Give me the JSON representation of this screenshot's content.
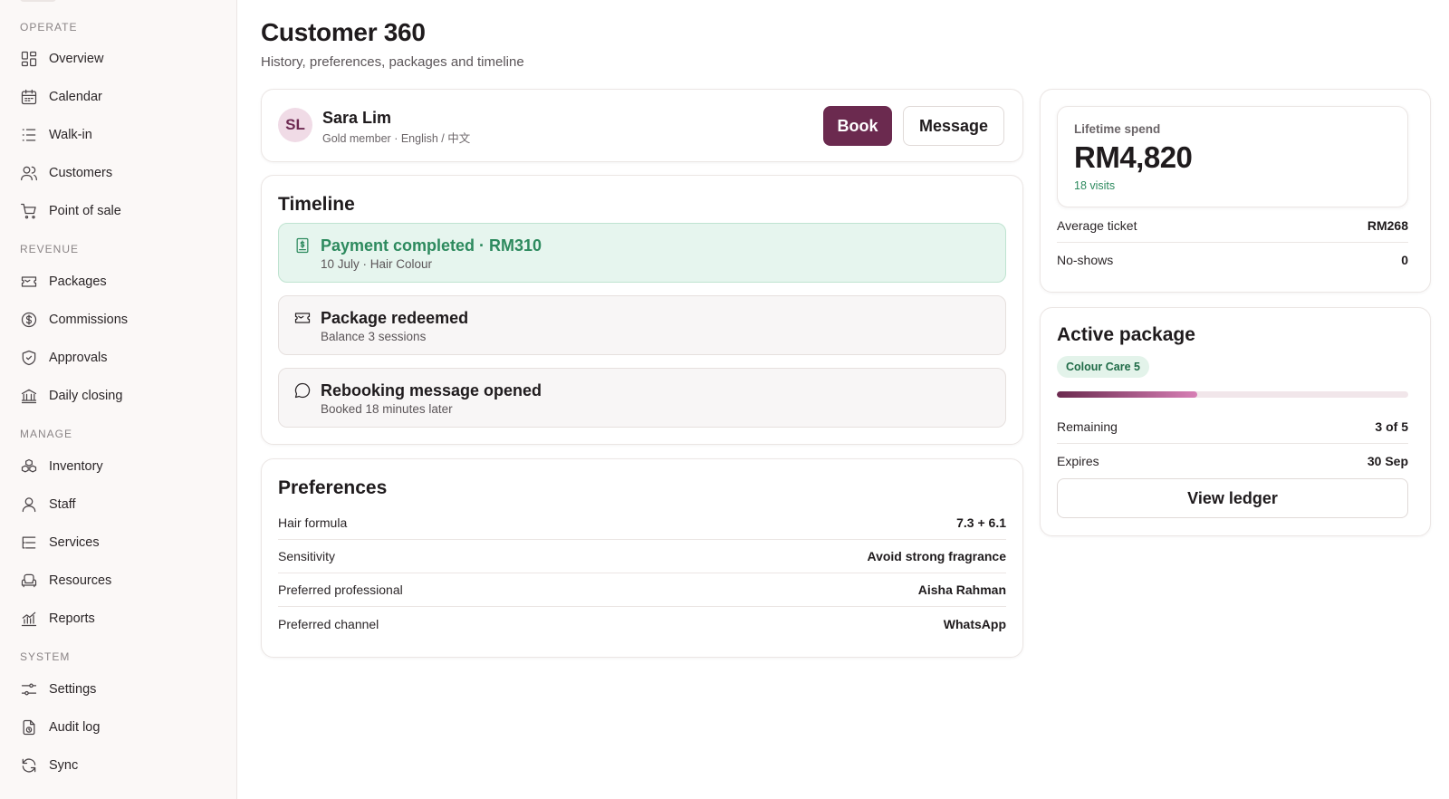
{
  "sidebar": {
    "sections": [
      {
        "label": "OPERATE",
        "items": [
          {
            "label": "Overview",
            "icon": "grid-icon"
          },
          {
            "label": "Calendar",
            "icon": "calendar-icon"
          },
          {
            "label": "Walk-in",
            "icon": "list-icon"
          },
          {
            "label": "Customers",
            "icon": "users-icon"
          },
          {
            "label": "Point of sale",
            "icon": "cart-icon"
          }
        ]
      },
      {
        "label": "REVENUE",
        "items": [
          {
            "label": "Packages",
            "icon": "ticket-icon"
          },
          {
            "label": "Commissions",
            "icon": "dollar-circle-icon"
          },
          {
            "label": "Approvals",
            "icon": "shield-check-icon"
          },
          {
            "label": "Daily closing",
            "icon": "bank-icon"
          }
        ]
      },
      {
        "label": "MANAGE",
        "items": [
          {
            "label": "Inventory",
            "icon": "boxes-icon"
          },
          {
            "label": "Staff",
            "icon": "user-icon"
          },
          {
            "label": "Services",
            "icon": "list-tree-icon"
          },
          {
            "label": "Resources",
            "icon": "armchair-icon"
          },
          {
            "label": "Reports",
            "icon": "chart-icon"
          }
        ]
      },
      {
        "label": "SYSTEM",
        "items": [
          {
            "label": "Settings",
            "icon": "sliders-icon"
          },
          {
            "label": "Audit log",
            "icon": "file-clock-icon"
          },
          {
            "label": "Sync",
            "icon": "refresh-icon"
          }
        ]
      }
    ]
  },
  "header": {
    "title": "Customer 360",
    "subtitle": "History, preferences, packages and timeline"
  },
  "profile": {
    "initials": "SL",
    "name": "Sara Lim",
    "meta": "Gold member · English / 中文",
    "book_label": "Book",
    "message_label": "Message"
  },
  "timeline": {
    "title": "Timeline",
    "items": [
      {
        "title": "Payment completed · RM310",
        "sub": "10 July · Hair Colour",
        "icon": "receipt-icon",
        "status": "success"
      },
      {
        "title": "Package redeemed",
        "sub": "Balance 3 sessions",
        "icon": "ticket-icon",
        "status": "neutral"
      },
      {
        "title": "Rebooking message opened",
        "sub": "Booked 18 minutes later",
        "icon": "chat-bubble-icon",
        "status": "neutral"
      }
    ]
  },
  "preferences": {
    "title": "Preferences",
    "rows": [
      {
        "key": "Hair formula",
        "value": "7.3 + 6.1"
      },
      {
        "key": "Sensitivity",
        "value": "Avoid strong fragrance"
      },
      {
        "key": "Preferred professional",
        "value": "Aisha Rahman"
      },
      {
        "key": "Preferred channel",
        "value": "WhatsApp"
      }
    ]
  },
  "stats": {
    "lifetime_label": "Lifetime spend",
    "lifetime_value": "RM4,820",
    "visits": "18 visits",
    "rows": [
      {
        "key": "Average ticket",
        "value": "RM268"
      },
      {
        "key": "No-shows",
        "value": "0"
      }
    ]
  },
  "package": {
    "title": "Active package",
    "name": "Colour Care 5",
    "progress_fraction": 0.4,
    "rows": [
      {
        "key": "Remaining",
        "value": "3 of 5"
      },
      {
        "key": "Expires",
        "value": "30 Sep"
      }
    ],
    "ledger_label": "View ledger"
  },
  "colors": {
    "accent": "#6b2a4f",
    "success": "#2d8a5e",
    "success_bg": "#e6f5ee"
  }
}
